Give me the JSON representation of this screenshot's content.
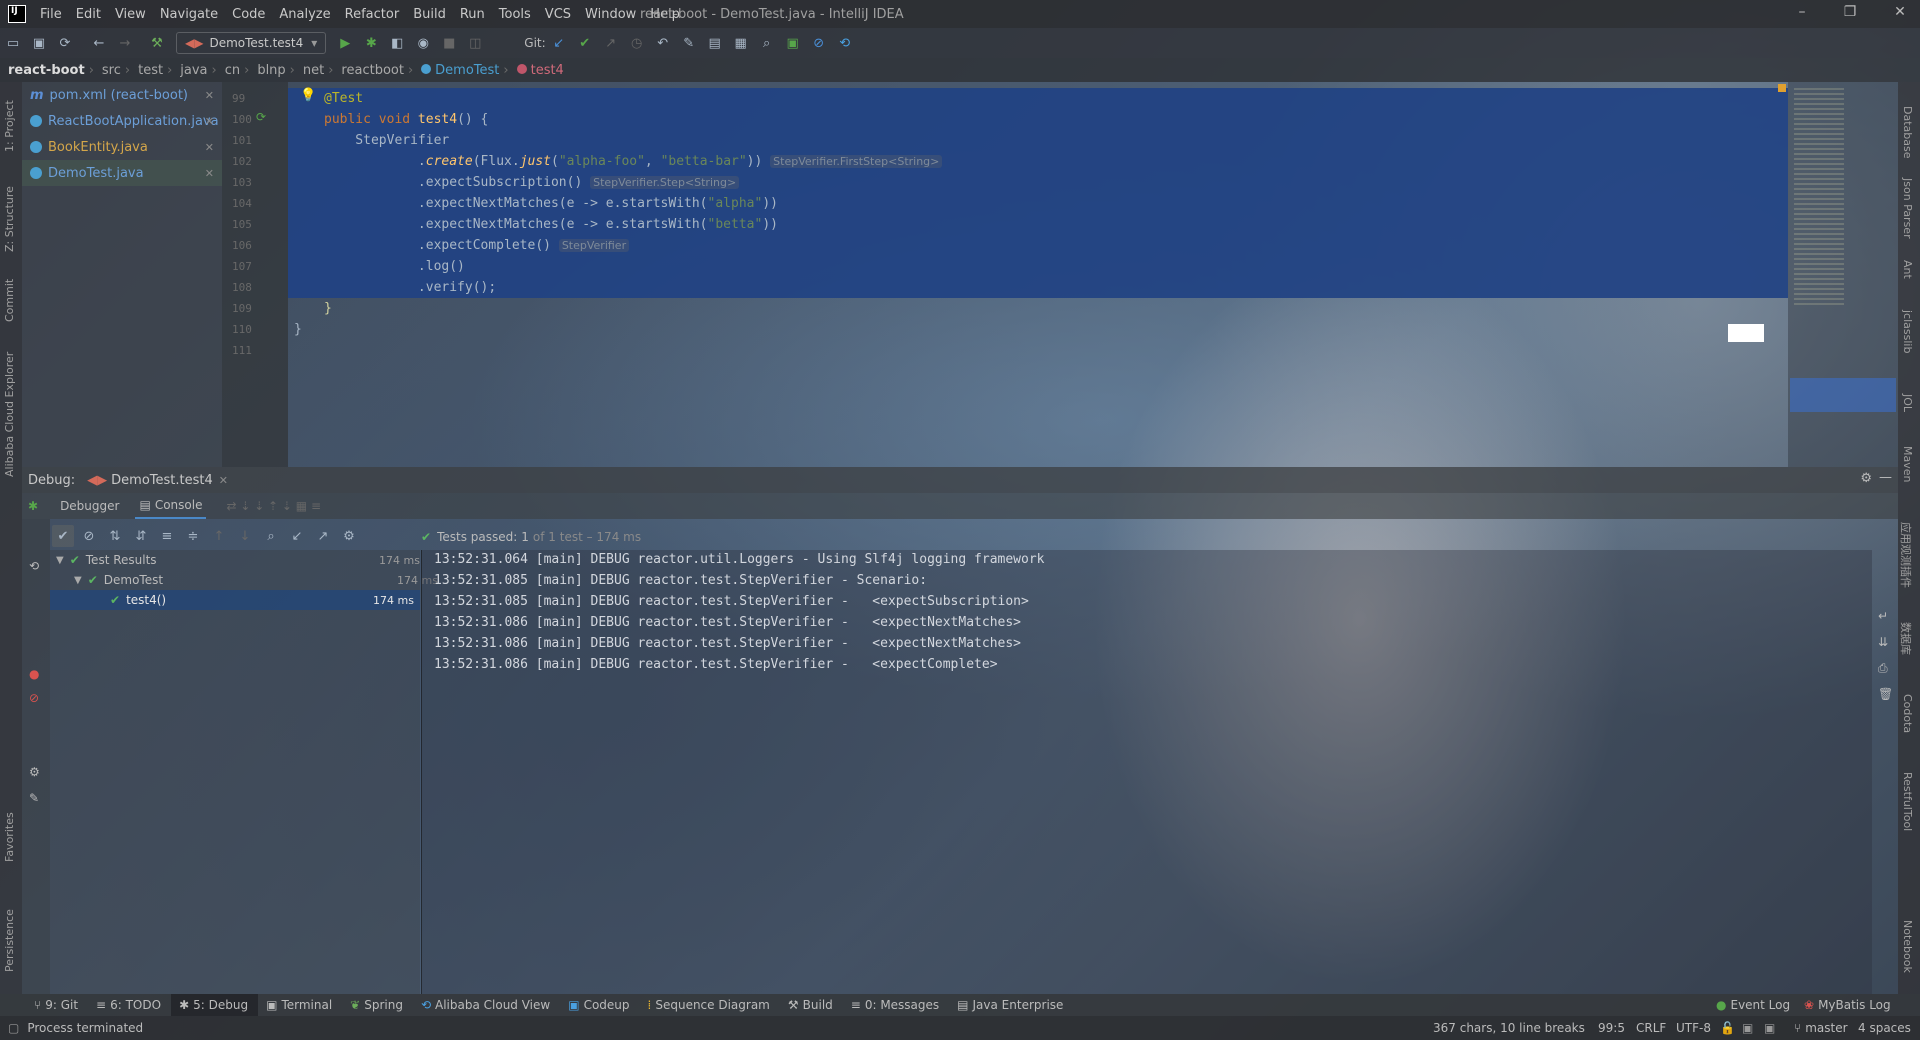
{
  "app": {
    "title": "react-boot - DemoTest.java - IntelliJ IDEA",
    "menu": [
      "File",
      "Edit",
      "View",
      "Navigate",
      "Code",
      "Analyze",
      "Refactor",
      "Build",
      "Run",
      "Tools",
      "VCS",
      "Window",
      "Help"
    ]
  },
  "toolbar": {
    "run_config": "DemoTest.test4",
    "git_label": "Git:"
  },
  "breadcrumb": [
    "react-boot",
    "src",
    "test",
    "java",
    "cn",
    "blnp",
    "net",
    "reactboot",
    "DemoTest",
    "test4"
  ],
  "left_strip": [
    "1: Project",
    "Z: Structure",
    "Commit",
    "Alibaba Cloud Explorer",
    "Favorites",
    "Persistence"
  ],
  "right_strip": [
    "Database",
    "Json Parser",
    "Ant",
    "jclasslib",
    "JOL",
    "Maven",
    "应用观测插件",
    "数据库",
    "Codota",
    "RestfulTool",
    "Notebook"
  ],
  "open_files": [
    {
      "name": "pom.xml (react-boot)",
      "icon": "maven-icon",
      "color": "#5c8fd6"
    },
    {
      "name": "ReactBootApplication.java",
      "icon": "class-icon",
      "color": "#5c8fd6"
    },
    {
      "name": "BookEntity.java",
      "icon": "class-icon",
      "color": "#d4a64a"
    },
    {
      "name": "DemoTest.java",
      "icon": "class-icon",
      "color": "#5c8fd6"
    }
  ],
  "editor": {
    "line_numbers": [
      "99",
      "100",
      "101",
      "102",
      "103",
      "104",
      "105",
      "106",
      "107",
      "108",
      "109",
      "110",
      "111"
    ],
    "lines": [
      {
        "text": "@Test"
      },
      {
        "text": "public void test4() {"
      },
      {
        "text": "    StepVerifier"
      },
      {
        "text": "            .create(Flux.just(\"alpha-foo\", \"betta-bar\"))",
        "hint": "StepVerifier.FirstStep<String>"
      },
      {
        "text": "            .expectSubscription()",
        "hint": "StepVerifier.Step<String>"
      },
      {
        "text": "            .expectNextMatches(e -> e.startsWith(\"alpha\"))"
      },
      {
        "text": "            .expectNextMatches(e -> e.startsWith(\"betta\"))"
      },
      {
        "text": "            .expectComplete()",
        "hint": "StepVerifier"
      },
      {
        "text": "            .log()"
      },
      {
        "text": "            .verify();"
      },
      {
        "text": "}"
      },
      {
        "text": "}"
      },
      {
        "text": ""
      }
    ]
  },
  "debug": {
    "label": "Debug:",
    "session": "DemoTest.test4",
    "tabs": [
      "Debugger",
      "Console"
    ],
    "tests_passed_label": "Tests passed:",
    "tests_passed_count": "1",
    "tests_passed_detail": "of 1 test – 174 ms",
    "tree": [
      {
        "label": "Test Results",
        "duration": "174 ms"
      },
      {
        "label": "DemoTest",
        "duration": "174 ms"
      },
      {
        "label": "test4()",
        "duration": "174 ms"
      }
    ],
    "console": [
      "13:52:31.064 [main] DEBUG reactor.util.Loggers - Using Slf4j logging framework",
      "13:52:31.085 [main] DEBUG reactor.test.StepVerifier - Scenario:",
      "13:52:31.085 [main] DEBUG reactor.test.StepVerifier -   <expectSubscription>",
      "13:52:31.086 [main] DEBUG reactor.test.StepVerifier -   <expectNextMatches>",
      "13:52:31.086 [main] DEBUG reactor.test.StepVerifier -   <expectNextMatches>",
      "13:52:31.086 [main] DEBUG reactor.test.StepVerifier -   <expectComplete>"
    ]
  },
  "bottom_tabs": [
    "9: Git",
    "6: TODO",
    "5: Debug",
    "Terminal",
    "Spring",
    "Alibaba Cloud View",
    "Codeup",
    "Sequence Diagram",
    "Build",
    "0: Messages",
    "Java Enterprise"
  ],
  "bottom_right_tabs": [
    "Event Log",
    "MyBatis Log"
  ],
  "status": {
    "message": "Process terminated",
    "chars": "367 chars, 10 line breaks",
    "position": "99:5",
    "line_sep": "CRLF",
    "encoding": "UTF-8",
    "branch": "master",
    "indent": "4 spaces"
  }
}
